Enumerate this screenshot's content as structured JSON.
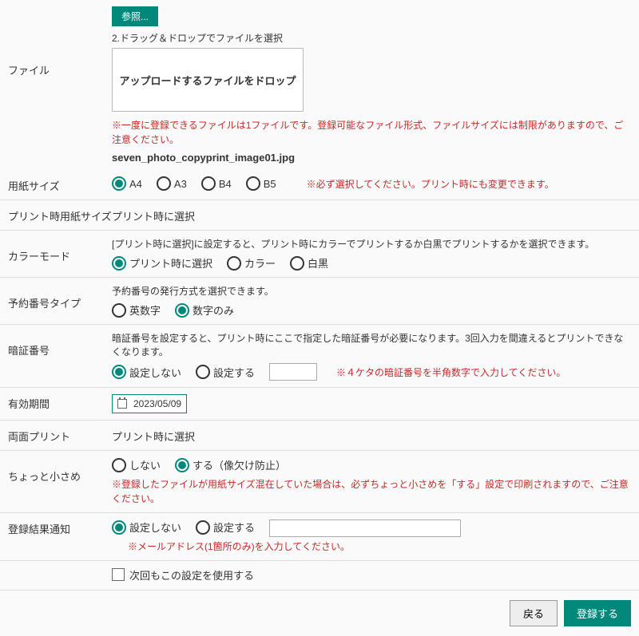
{
  "file": {
    "label": "ファイル",
    "browse_btn": "参照...",
    "drag_drop_heading": "2.ドラッグ＆ドロップでファイルを選択",
    "drop_text": "アップロードするファイルをドロップ",
    "warn": "※一度に登録できるファイルは1ファイルです。登録可能なファイル形式、ファイルサイズには制限がありますので、ご注意ください。",
    "filename": "seven_photo_copyprint_image01.jpg"
  },
  "paper_size": {
    "label": "用紙サイズ",
    "options": [
      "A4",
      "A3",
      "B4",
      "B5"
    ],
    "selected": "A4",
    "warn": "※必ず選択してください。プリント時にも変更できます。"
  },
  "print_paper_size": {
    "label": "プリント時用紙サイズ",
    "value": "プリント時に選択"
  },
  "color_mode": {
    "label": "カラーモード",
    "desc": "[プリント時に選択]に設定すると、プリント時にカラーでプリントするか白黒でプリントするかを選択できます。",
    "options": [
      "プリント時に選択",
      "カラー",
      "白黒"
    ],
    "selected": "プリント時に選択"
  },
  "reservation_type": {
    "label": "予約番号タイプ",
    "desc": "予約番号の発行方式を選択できます。",
    "options": [
      "英数字",
      "数字のみ"
    ],
    "selected": "数字のみ"
  },
  "pin": {
    "label": "暗証番号",
    "desc": "暗証番号を設定すると、プリント時にここで指定した暗証番号が必要になります。3回入力を間違えるとプリントできなくなります。",
    "options": [
      "設定しない",
      "設定する"
    ],
    "selected": "設定しない",
    "input_value": "",
    "warn": "※４ケタの暗証番号を半角数字で入力してください。"
  },
  "validity": {
    "label": "有効期間",
    "value": "2023/05/09"
  },
  "duplex": {
    "label": "両面プリント",
    "value": "プリント時に選択"
  },
  "shrink": {
    "label": "ちょっと小さめ",
    "options": [
      "しない",
      "する（像欠け防止）"
    ],
    "selected": "する（像欠け防止）",
    "warn": "※登録したファイルが用紙サイズ混在していた場合は、必ずちょっと小さめを「する」設定で印刷されますので、ご注意ください。"
  },
  "notify": {
    "label": "登録結果通知",
    "options": [
      "設定しない",
      "設定する"
    ],
    "selected": "設定しない",
    "input_value": "",
    "warn": "※メールアドレス(1箇所のみ)を入力してください。"
  },
  "remember": {
    "label": "次回もこの設定を使用する",
    "checked": false
  },
  "footer": {
    "back": "戻る",
    "submit": "登録する"
  }
}
